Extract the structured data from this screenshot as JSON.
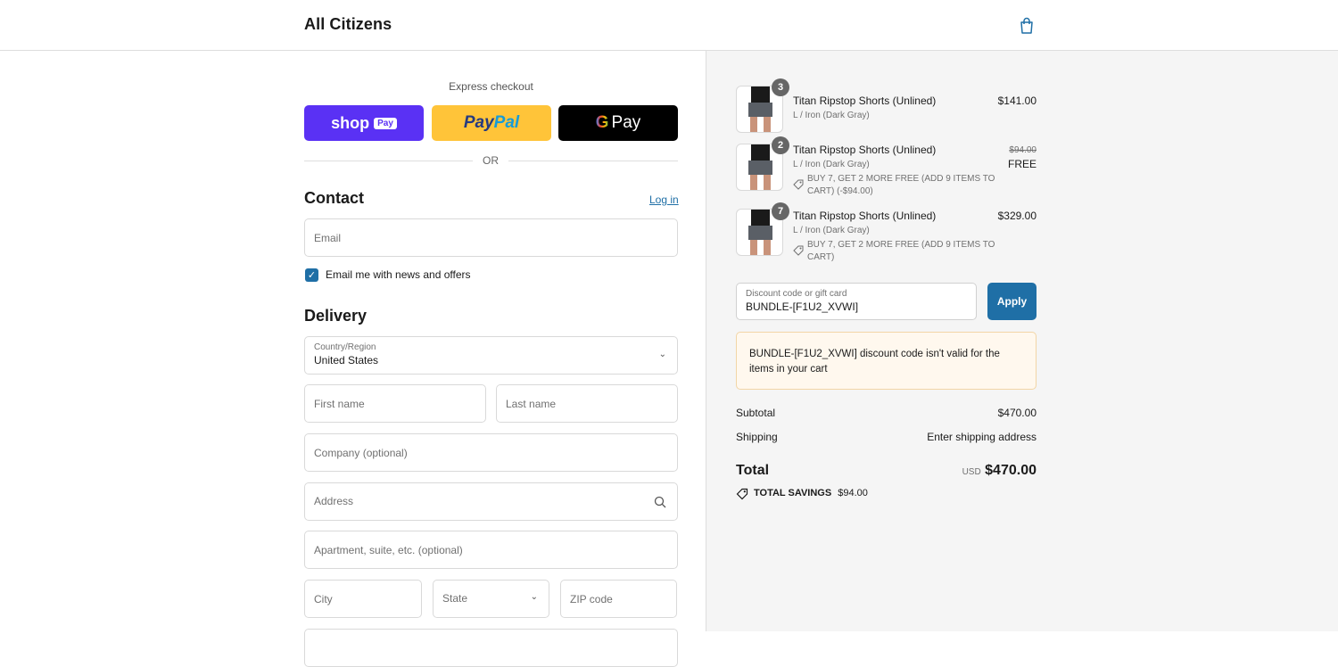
{
  "header": {
    "brand": "All Citizens",
    "cart_icon": "shopping-bag-icon"
  },
  "express": {
    "label": "Express checkout",
    "shop_pay": {
      "text": "shop",
      "tag": "Pay"
    },
    "paypal": {
      "part1": "Pay",
      "part2": "Pal"
    },
    "gpay": {
      "g": "G",
      "text": "Pay"
    },
    "or": "OR"
  },
  "contact": {
    "heading": "Contact",
    "login": "Log in",
    "email_placeholder": "Email",
    "newsletter_label": "Email me with news and offers",
    "newsletter_checked": true
  },
  "delivery": {
    "heading": "Delivery",
    "country_label": "Country/Region",
    "country_value": "United States",
    "first_name": "First name",
    "last_name": "Last name",
    "company": "Company (optional)",
    "address": "Address",
    "apartment": "Apartment, suite, etc. (optional)",
    "city": "City",
    "state": "State",
    "zip": "ZIP code"
  },
  "cart": {
    "items": [
      {
        "qty": "3",
        "title": "Titan Ripstop Shorts (Unlined)",
        "variant": "L / Iron (Dark Gray)",
        "price": "$141.00"
      },
      {
        "qty": "2",
        "title": "Titan Ripstop Shorts (Unlined)",
        "variant": "L / Iron (Dark Gray)",
        "promo_line1": "BUY 7, GET 2 MORE FREE (ADD 9 ITEMS TO",
        "promo_line2": "CART) (-$94.00)",
        "original_price": "$94.00",
        "price": "FREE"
      },
      {
        "qty": "7",
        "title": "Titan Ripstop Shorts (Unlined)",
        "variant": "L / Iron (Dark Gray)",
        "promo_line1": "BUY 7, GET 2 MORE FREE (ADD 9 ITEMS TO",
        "promo_line2": "CART)",
        "price": "$329.00"
      }
    ],
    "discount": {
      "label": "Discount code or gift card",
      "value": "BUNDLE-[F1U2_XVWI]",
      "apply": "Apply"
    },
    "alert": {
      "code": "BUNDLE-[F1U2_XVWI]",
      "message": " discount code isn't valid for the items in your cart"
    },
    "summary": {
      "subtotal_label": "Subtotal",
      "subtotal_value": "$470.00",
      "shipping_label": "Shipping",
      "shipping_value": "Enter shipping address",
      "total_label": "Total",
      "currency": "USD",
      "total_value": "$470.00",
      "savings_label": "TOTAL SAVINGS",
      "savings_value": "$94.00"
    }
  }
}
